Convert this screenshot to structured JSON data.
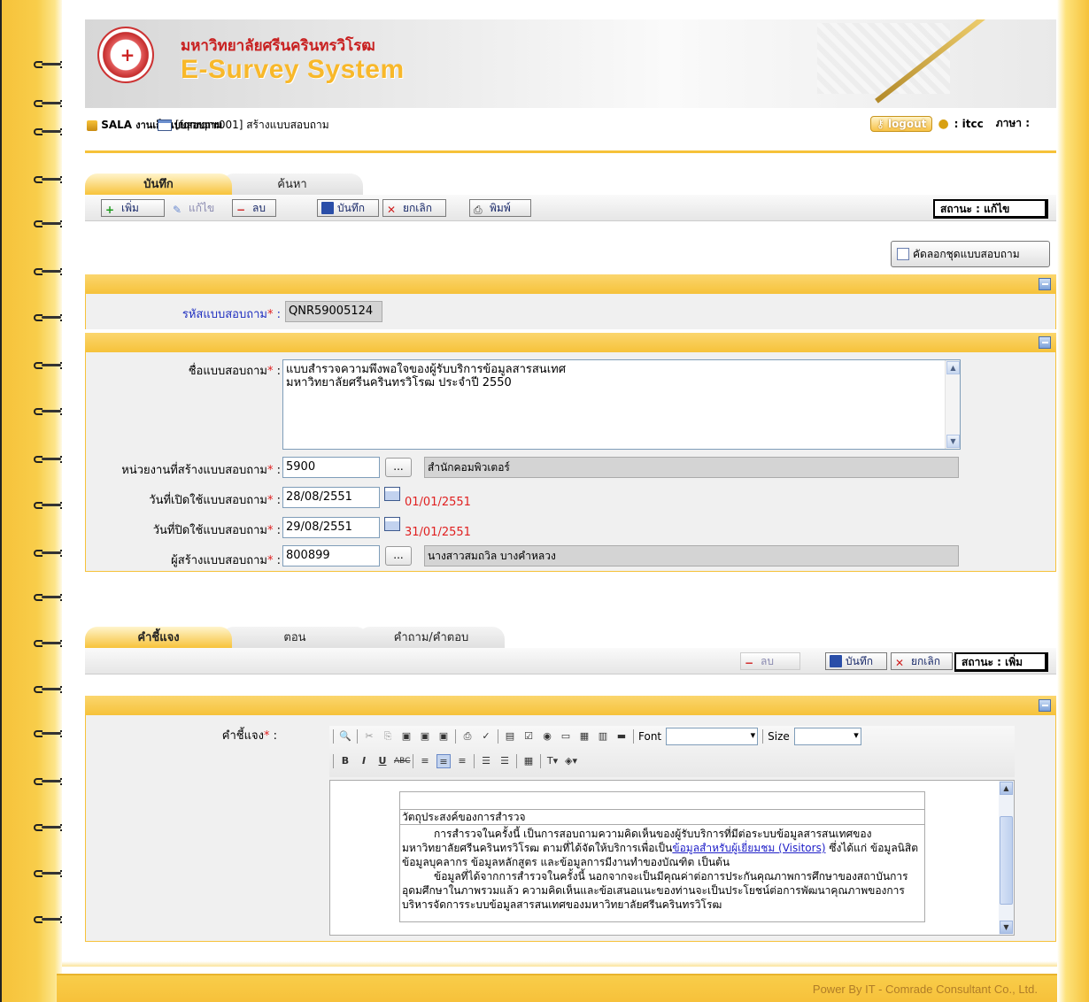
{
  "header": {
    "university": "มหาวิทยาลัยศรีนครินทรวิโรฒ",
    "system_name": "E-Survey System"
  },
  "breadcrumb": {
    "crumb_left": "SALA",
    "crumb_left_sub": "งานเก็บแบบสอบถาม",
    "crumb_screen": "[fqnrqnr001] สร้างแบบสอบถาม",
    "logout_label": "logout",
    "user": ": itcc",
    "language_label": "ภาษา :"
  },
  "tabs_top": [
    {
      "label": "บันทึก",
      "active": true
    },
    {
      "label": "ค้นหา",
      "active": false
    }
  ],
  "toolbar_top": {
    "add_label": "เพิ่ม",
    "edit_label": "แก้ไข",
    "delete_label": "ลบ",
    "save_label": "บันทึก",
    "cancel_label": "ยกเลิก",
    "print_label": "พิมพ์",
    "status": "สถานะ : แก้ไข"
  },
  "copy_button": "คัดลอกชุดแบบสอบถาม",
  "form": {
    "code_label": "รหัสแบบสอบถาม",
    "code_value": "QNR59005124",
    "name_label": "ชื่อแบบสอบถาม",
    "name_line1": "แบบสำรวจความพึงพอใจของผู้รับบริการข้อมูลสารสนเทศ",
    "name_line2": "มหาวิทยาลัยศรีนครินทรวิโรฒ ประจำปี 2550",
    "unit_label": "หน่วยงานที่สร้างแบบสอบถาม",
    "unit_code": "5900",
    "unit_name": "สำนักคอมพิวเตอร์",
    "open_label": "วันที่เปิดใช้แบบสอบถาม",
    "open_value": "28/08/2551",
    "open_hint": "01/01/2551",
    "close_label": "วันที่ปิดใช้แบบสอบถาม",
    "close_value": "29/08/2551",
    "close_hint": "31/01/2551",
    "creator_label": "ผู้สร้างแบบสอบถาม",
    "creator_code": "800899",
    "creator_name": "นางสาวสมถวิล บางคำหลวง",
    "required_mark": "*",
    "colon": ":",
    "dots": "..."
  },
  "tabs_bottom": [
    {
      "label": "คำชี้แจง",
      "active": true
    },
    {
      "label": "ตอน",
      "active": false
    },
    {
      "label": "คำถาม/คำตอบ",
      "active": false
    }
  ],
  "toolbar_bottom": {
    "delete_label": "ลบ",
    "save_label": "บันทึก",
    "cancel_label": "ยกเลิก",
    "status": "สถานะ : เพิ่ม"
  },
  "editor": {
    "label": "คำชี้แจง",
    "font_label": "Font",
    "size_label": "Size",
    "heading": "วัตถุประสงค์ของการสำรวจ",
    "para1_a": "การสำรวจในครั้งนี้ เป็นการสอบถามความคิดเห็นของผู้รับบริการที่มีต่อระบบข้อมูลสารสนเทศของมหาวิทยาลัยศรีนครินทรวิโรฒ ตามที่ได้จัดให้บริการเพื่อเป็น",
    "para1_link": "ข้อมูลสำหรับผู้เยี่ยมชม (Visitors)",
    "para1_b": " ซึ่งได้แก่ ข้อมูลนิสิต ข้อมูลบุคลากร ข้อมูลหลักสูตร และข้อมูลการมีงานทำของบัณฑิต เป็นต้น",
    "para2": "ข้อมูลที่ได้จากการสำรวจในครั้งนี้ นอกจากจะเป็นมีคุณค่าต่อการประกันคุณภาพการศึกษาของสถาบันการอุดมศึกษาในภาพรวมแล้ว ความคิดเห็นและข้อเสนอแนะของท่านจะเป็นประโยชน์ต่อการพัฒนาคุณภาพของการบริหารจัดการระบบข้อมูลสารสนเทศของมหาวิทยาลัยศรีนครินทรวิโรฒ"
  },
  "footer": "Power By IT - Comrade Consultant Co., Ltd.",
  "colors": {
    "accent": "#f6c23a",
    "required": "#e02020",
    "label_blue": "#2030c0"
  }
}
